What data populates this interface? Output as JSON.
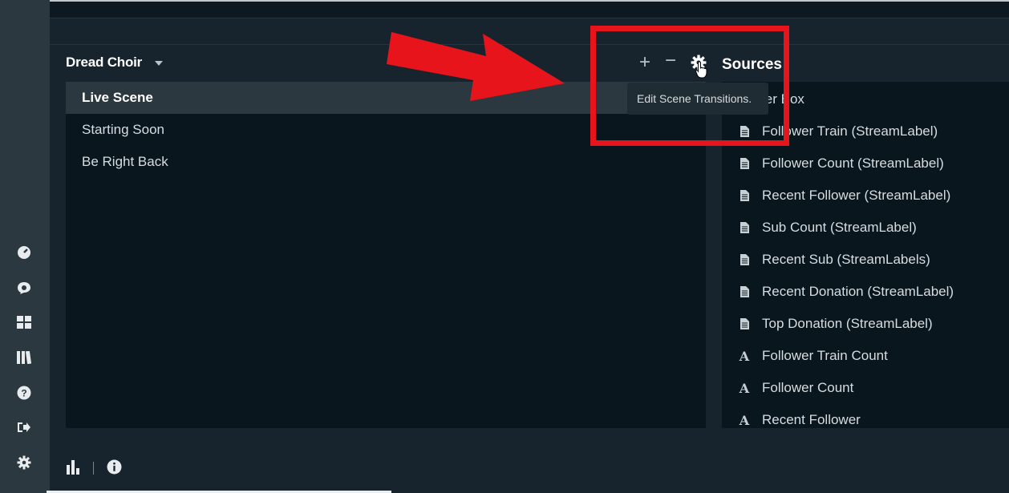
{
  "scenes": {
    "collection_name": "Dread Choir",
    "items": [
      {
        "label": "Live Scene",
        "active": true
      },
      {
        "label": "Starting Soon",
        "active": false
      },
      {
        "label": "Be Right Back",
        "active": false
      }
    ],
    "add_label": "+",
    "remove_label": "−"
  },
  "tooltip": {
    "text": "Edit Scene Transitions."
  },
  "sources": {
    "title": "Sources",
    "items": [
      {
        "label": "ler  Box",
        "icon": "file-icon"
      },
      {
        "label": "Follower Train (StreamLabel)",
        "icon": "file-icon"
      },
      {
        "label": "Follower Count (StreamLabel)",
        "icon": "file-icon"
      },
      {
        "label": "Recent Follower (StreamLabel)",
        "icon": "file-icon"
      },
      {
        "label": "Sub Count (StreamLabel)",
        "icon": "file-icon"
      },
      {
        "label": "Recent Sub (StreamLabels)",
        "icon": "file-icon"
      },
      {
        "label": "Recent Donation (StreamLabel)",
        "icon": "file-icon"
      },
      {
        "label": "Top Donation (StreamLabel)",
        "icon": "file-icon"
      },
      {
        "label": "Follower Train Count",
        "icon": "text-icon"
      },
      {
        "label": "Follower Count",
        "icon": "text-icon"
      },
      {
        "label": "Recent Follower",
        "icon": "text-icon"
      }
    ]
  },
  "annotation": {
    "arrow_color": "#e8141c",
    "box_color": "#e8141c"
  },
  "colors": {
    "background": "#17242d",
    "panel": "#09161d",
    "sidebar": "#2b3840"
  }
}
